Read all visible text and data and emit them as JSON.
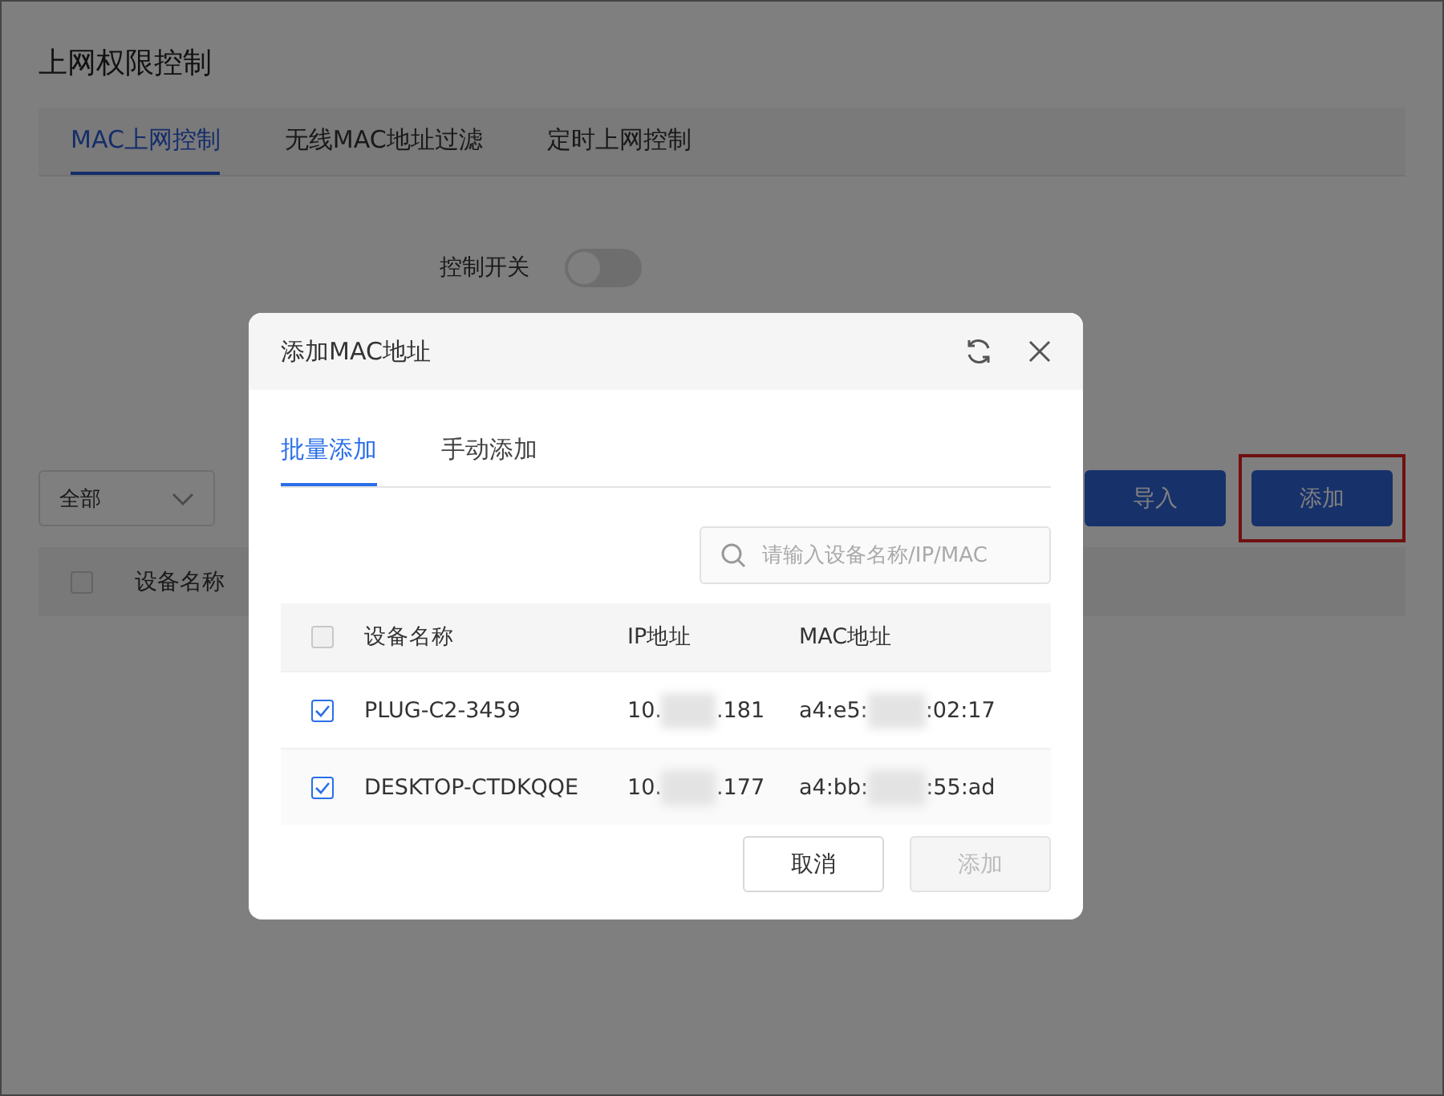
{
  "page": {
    "title": "上网权限控制",
    "tabs": [
      {
        "label": "MAC上网控制",
        "selected": true
      },
      {
        "label": "无线MAC地址过滤",
        "selected": false
      },
      {
        "label": "定时上网控制",
        "selected": false
      }
    ],
    "control_switch": {
      "label": "控制开关",
      "on": false
    },
    "toolbar": {
      "filter": "全部",
      "import_button": "导入",
      "add_button": "添加",
      "add_highlighted": true
    },
    "table": {
      "columns": [
        "设备名称"
      ],
      "all_checked": false
    }
  },
  "dialog": {
    "title": "添加MAC地址",
    "tabs": [
      {
        "label": "批量添加",
        "selected": true
      },
      {
        "label": "手动添加",
        "selected": false
      }
    ],
    "search": {
      "placeholder": "请输入设备名称/IP/MAC"
    },
    "columns": [
      "设备名称",
      "IP地址",
      "MAC地址"
    ],
    "all_checked": false,
    "rows": [
      {
        "name": "PLUG-C2-3459",
        "ip_start": "10.",
        "ip_end": ".181",
        "mac_start": "a4:e5:",
        "mac_end": ":02:17",
        "checked": true
      },
      {
        "name": "DESKTOP-CTDKQQE",
        "ip_start": "10.",
        "ip_end": ".177",
        "mac_start": "a4:bb:",
        "mac_end": ":55:ad",
        "checked": true
      }
    ],
    "cancel_button": "取消",
    "add_button": {
      "label": "添加",
      "disabled": true
    }
  }
}
